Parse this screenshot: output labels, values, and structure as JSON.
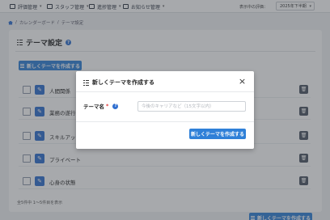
{
  "nav": {
    "items": [
      {
        "label": "評価管理"
      },
      {
        "label": "スタッフ管理"
      },
      {
        "label": "進捗管理"
      },
      {
        "label": "お知らせ管理"
      }
    ],
    "period_label": "表示中の評価：",
    "period_value": "2025年下半期"
  },
  "breadcrumb": {
    "items": [
      "カレンダーボード",
      "テーマ設定"
    ],
    "separator": "/"
  },
  "page": {
    "title": "テーマ設定",
    "create_button_label": "新しくテーマを作成する",
    "themes": [
      {
        "name": "人間関係"
      },
      {
        "name": "業務の遂行"
      },
      {
        "name": "スキルアップ"
      },
      {
        "name": "プライベート"
      },
      {
        "name": "心身の状態"
      }
    ],
    "pagination_info": "全5件中 1〜5件目を表示",
    "edit_icon": "pencil-icon",
    "delete_icon": "trash-icon"
  },
  "modal": {
    "title": "新しくテーマを作成する",
    "close_icon": "×",
    "field_label": "テーマ名",
    "required_mark": "*",
    "input_placeholder": "今後のキャリアなど（15文字以内）",
    "input_value": "",
    "submit_label": "新しくテーマを作成する"
  },
  "colors": {
    "primary": "#2f80d8",
    "accent_blue": "#2f6fd0",
    "required": "#e03131",
    "delete_button": "#4b5563"
  }
}
